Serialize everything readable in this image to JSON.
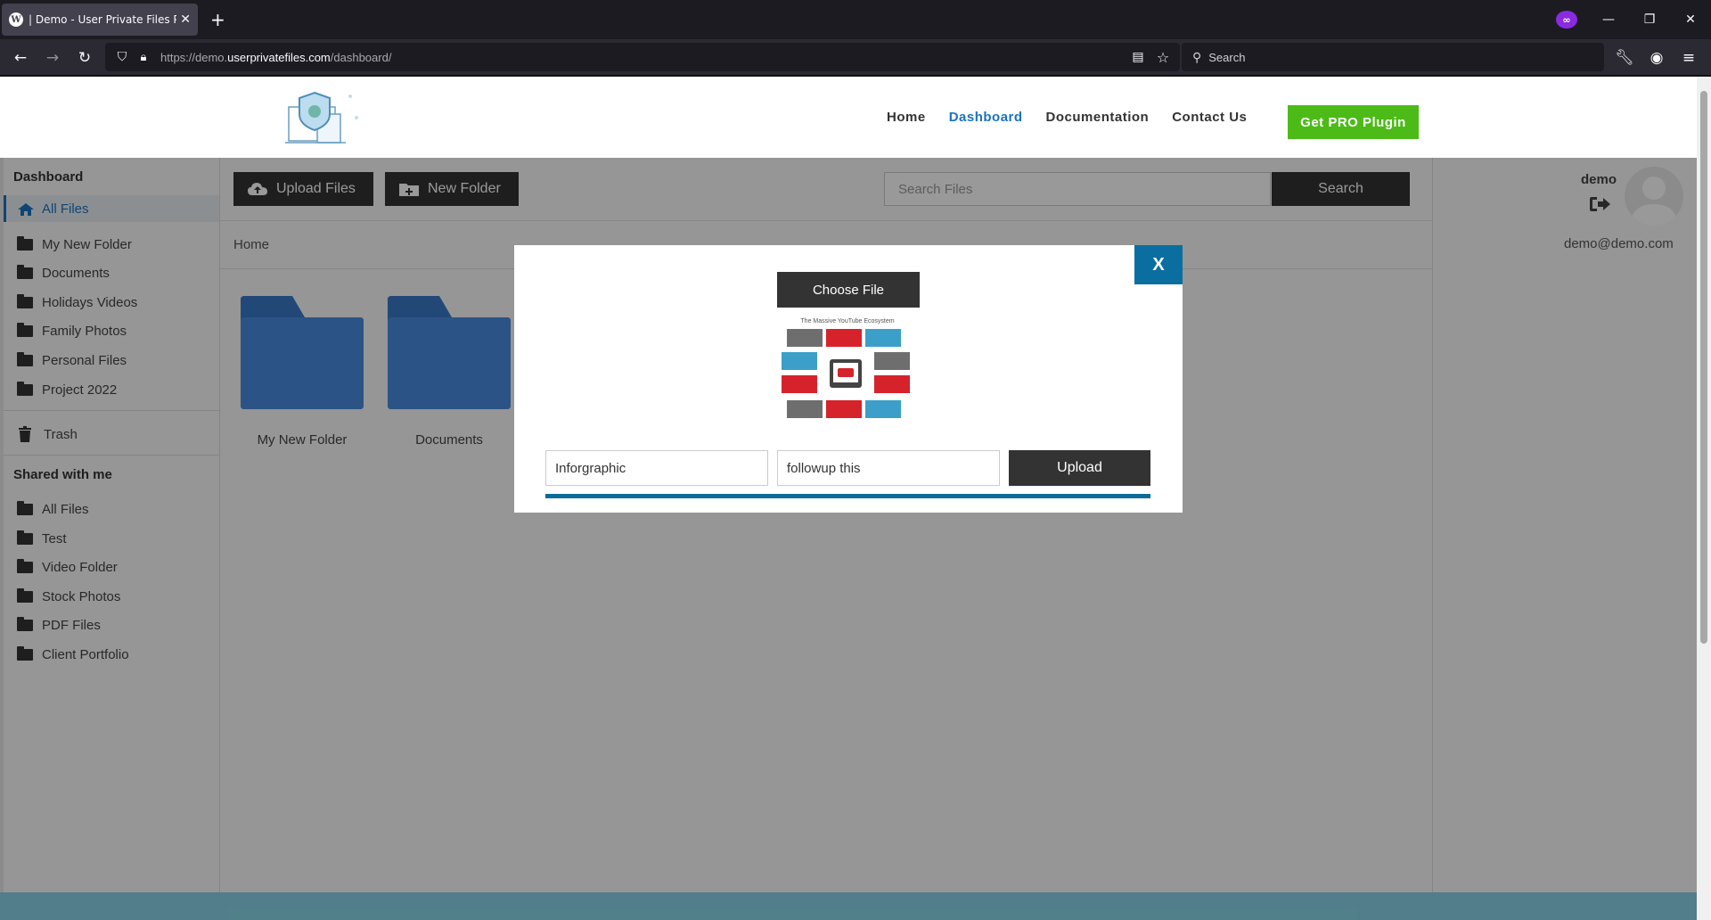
{
  "browser": {
    "tab_title": "| Demo - User Private Files PRO",
    "url_prefix": "https://demo.",
    "url_domain": "userprivatefiles.com",
    "url_path": "/dashboard/",
    "search_placeholder": "Search"
  },
  "header": {
    "nav": [
      "Home",
      "Dashboard",
      "Documentation",
      "Contact Us"
    ],
    "active_nav": "Dashboard",
    "cta_label": "Get PRO Plugin"
  },
  "sidebar": {
    "dashboard_heading": "Dashboard",
    "all_files": "All Files",
    "folders": [
      "My New Folder",
      "Documents",
      "Holidays Videos",
      "Family Photos",
      "Personal Files",
      "Project 2022"
    ],
    "trash": "Trash",
    "shared_heading": "Shared with me",
    "shared": [
      "All Files",
      "Test",
      "Video Folder",
      "Stock Photos",
      "PDF Files",
      "Client Portfolio"
    ]
  },
  "toolbar": {
    "upload_label": "Upload Files",
    "new_folder_label": "New Folder",
    "search_placeholder": "Search Files",
    "search_label": "Search"
  },
  "main": {
    "breadcrumb": "Home",
    "folders": [
      "My New Folder",
      "Documents"
    ]
  },
  "user": {
    "name": "demo",
    "email": "demo@demo.com"
  },
  "modal": {
    "close_label": "X",
    "choose_file_label": "Choose File",
    "thumb_title": "The Massive YouTube Ecosystem",
    "title_value": "Inforgraphic",
    "description_value": "followup this",
    "upload_label": "Upload",
    "progress": 1.0
  },
  "colors": {
    "accent": "#1a73c2",
    "cta": "#4cbb17",
    "modal_close": "#0a6fa0",
    "progress": "#0c6c99",
    "footer": "#87d3e6"
  }
}
